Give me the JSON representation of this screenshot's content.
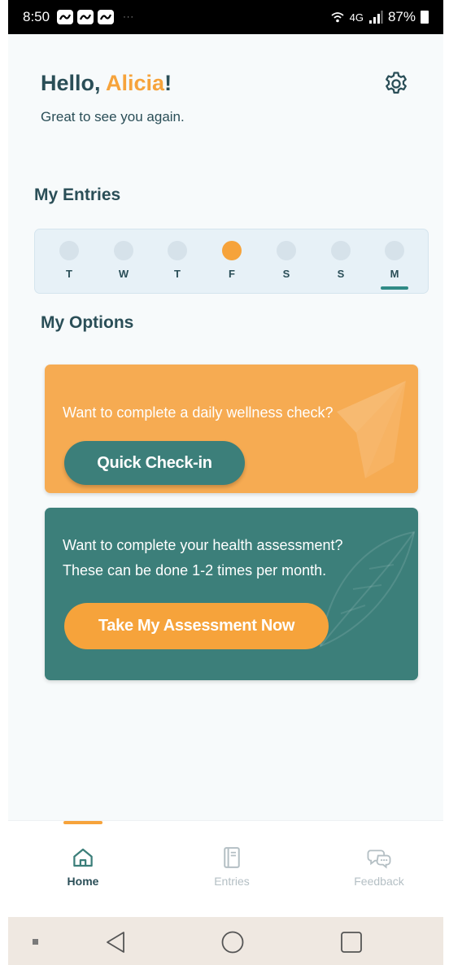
{
  "status_bar": {
    "time": "8:50",
    "network": "4G",
    "battery": "87%"
  },
  "header": {
    "greeting_prefix": "Hello, ",
    "user_name": "Alicia",
    "greeting_suffix": "!",
    "subtitle": "Great to see you again."
  },
  "entries": {
    "title": "My Entries",
    "days": [
      {
        "label": "T",
        "filled": false,
        "current": false
      },
      {
        "label": "W",
        "filled": false,
        "current": false
      },
      {
        "label": "T",
        "filled": false,
        "current": false
      },
      {
        "label": "F",
        "filled": true,
        "current": false
      },
      {
        "label": "S",
        "filled": false,
        "current": false
      },
      {
        "label": "S",
        "filled": false,
        "current": false
      },
      {
        "label": "M",
        "filled": false,
        "current": true
      }
    ]
  },
  "options": {
    "title": "My Options",
    "checkin_card": {
      "text": "Want to complete a daily wellness check?",
      "button": "Quick Check-in"
    },
    "assessment_card": {
      "text_line1": "Want to complete your health assessment?",
      "text_line2": "These can be done 1-2 times per month.",
      "button": "Take My Assessment Now"
    }
  },
  "bottom_nav": {
    "items": [
      {
        "label": "Home",
        "icon": "home-icon",
        "active": true
      },
      {
        "label": "Entries",
        "icon": "notebook-icon",
        "active": false
      },
      {
        "label": "Feedback",
        "icon": "chat-bubbles-icon",
        "active": false
      }
    ]
  },
  "colors": {
    "primary_teal": "#3c7f7a",
    "accent_orange": "#f6a33b",
    "heading": "#2a4e57",
    "inactive_nav": "#b4bfc4"
  }
}
